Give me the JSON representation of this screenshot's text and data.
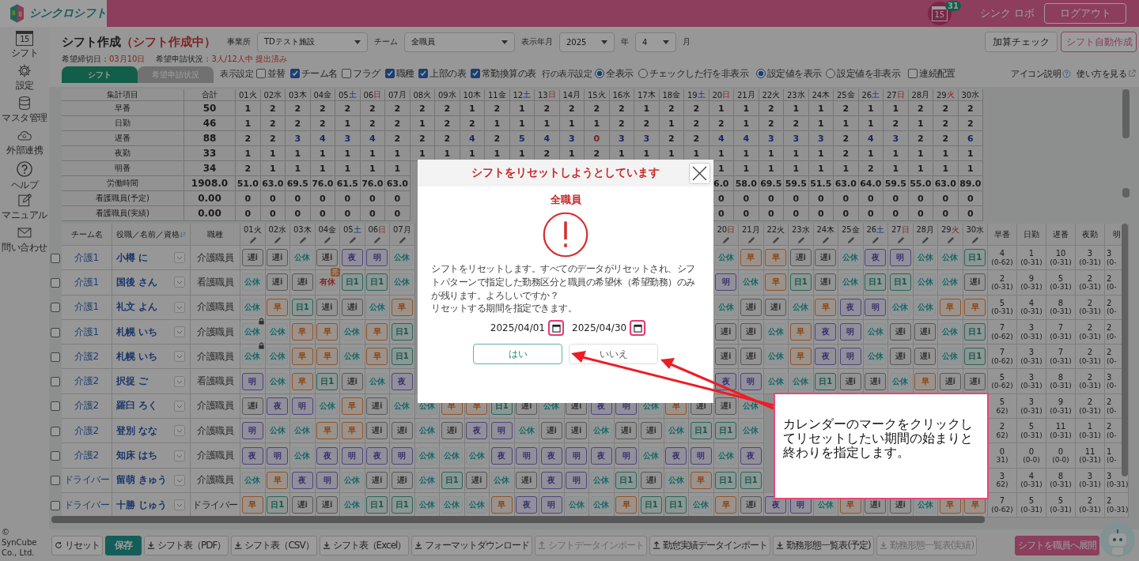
{
  "topbar": {
    "brand": "シンクロシフト",
    "calendar_day": "15",
    "notification_count": "31",
    "user": "シンク ロボ",
    "logout": "ログアウト"
  },
  "sidebar": {
    "items": [
      {
        "label": "シフト",
        "day": "15"
      },
      {
        "label": "設定"
      },
      {
        "label": "マスタ管理"
      },
      {
        "label": "外部連携"
      },
      {
        "label": "ヘルプ"
      },
      {
        "label": "マニュアル"
      },
      {
        "label": "問い合わせ"
      }
    ],
    "copyright": "© SynCube Co., Ltd."
  },
  "header": {
    "title": "シフト作成",
    "status": "（シフト作成中）",
    "filters": [
      {
        "label": "事業所",
        "value": "TDテスト施設"
      },
      {
        "label": "チーム",
        "value": "全職員"
      },
      {
        "label": "表示年月",
        "value": "2025",
        "unit": "年"
      },
      {
        "value": "4",
        "unit": "月"
      }
    ],
    "actions": [
      {
        "label": "加算チェック",
        "kind": "default"
      },
      {
        "label": "シフト自動作成",
        "kind": "accent"
      }
    ],
    "deadline": {
      "label": "希望締切日：",
      "value": "03月10日"
    },
    "requests": {
      "label": "希望申請状況：",
      "value": "3人/12人中 提出済み"
    }
  },
  "tabs": [
    {
      "label": "シフト",
      "selected": true
    },
    {
      "label": "希望申請状況",
      "selected": false
    }
  ],
  "settings": {
    "display_label": "表示設定",
    "checkboxes": [
      {
        "label": "並替",
        "checked": false
      },
      {
        "label": "チーム名",
        "checked": true
      },
      {
        "label": "フラグ",
        "checked": false
      },
      {
        "label": "職種",
        "checked": true
      },
      {
        "label": "上部の表",
        "checked": true
      },
      {
        "label": "常勤換算の表",
        "checked": true
      }
    ],
    "row_label": "行の表示設定",
    "radio_groups": [
      [
        {
          "label": "全表示",
          "selected": true
        },
        {
          "label": "チェックした行を非表示",
          "selected": false
        }
      ],
      [
        {
          "label": "設定値を表示",
          "selected": true
        },
        {
          "label": "設定値を非表示",
          "selected": false
        }
      ]
    ],
    "extra_checkbox": {
      "label": "連続配置",
      "checked": false
    },
    "icon_help": "アイコン説明",
    "how_to": "使い方を見る"
  },
  "summary": {
    "label_header": "集計項目",
    "total_header": "合計",
    "days": [
      {
        "date": "01",
        "weekday": "火",
        "kind": "weekday"
      },
      {
        "date": "02",
        "weekday": "水",
        "kind": "weekday"
      },
      {
        "date": "03",
        "weekday": "木",
        "kind": "weekday"
      },
      {
        "date": "04",
        "weekday": "金",
        "kind": "weekday"
      },
      {
        "date": "05",
        "weekday": "土",
        "kind": "saturday"
      },
      {
        "date": "06",
        "weekday": "日",
        "kind": "holiday"
      },
      {
        "date": "07",
        "weekday": "月",
        "kind": "weekday"
      },
      {
        "date": "08",
        "weekday": "火",
        "kind": "weekday"
      },
      {
        "date": "09",
        "weekday": "水",
        "kind": "weekday"
      },
      {
        "date": "10",
        "weekday": "木",
        "kind": "weekday"
      },
      {
        "date": "11",
        "weekday": "金",
        "kind": "weekday"
      },
      {
        "date": "12",
        "weekday": "土",
        "kind": "saturday"
      },
      {
        "date": "13",
        "weekday": "日",
        "kind": "holiday"
      },
      {
        "date": "14",
        "weekday": "月",
        "kind": "weekday"
      },
      {
        "date": "15",
        "weekday": "火",
        "kind": "weekday"
      },
      {
        "date": "16",
        "weekday": "水",
        "kind": "weekday"
      },
      {
        "date": "17",
        "weekday": "木",
        "kind": "weekday"
      },
      {
        "date": "18",
        "weekday": "金",
        "kind": "weekday"
      },
      {
        "date": "19",
        "weekday": "土",
        "kind": "saturday"
      },
      {
        "date": "20",
        "weekday": "日",
        "kind": "holiday"
      },
      {
        "date": "21",
        "weekday": "月",
        "kind": "weekday"
      },
      {
        "date": "22",
        "weekday": "火",
        "kind": "weekday"
      },
      {
        "date": "23",
        "weekday": "水",
        "kind": "weekday"
      },
      {
        "date": "24",
        "weekday": "木",
        "kind": "weekday"
      },
      {
        "date": "25",
        "weekday": "金",
        "kind": "weekday"
      },
      {
        "date": "26",
        "weekday": "土",
        "kind": "saturday"
      },
      {
        "date": "27",
        "weekday": "日",
        "kind": "holiday"
      },
      {
        "date": "28",
        "weekday": "月",
        "kind": "weekday"
      },
      {
        "date": "29",
        "weekday": "火",
        "kind": "holiday"
      },
      {
        "date": "30",
        "weekday": "水",
        "kind": "weekday"
      }
    ],
    "rows": [
      {
        "label": "早番",
        "total": "50",
        "values": [
          "1",
          "2",
          "2",
          "2",
          "2",
          "2",
          "2",
          "2",
          "2",
          "1",
          "2",
          "1",
          "2",
          "2",
          "2",
          "2",
          "1",
          "2",
          "2",
          "1",
          "1",
          "2",
          "1",
          "1",
          "2",
          "1",
          "1",
          "2",
          "2",
          "2"
        ]
      },
      {
        "label": "日勤",
        "total": "46",
        "values": [
          "1",
          "2",
          "2",
          "2",
          "1",
          "2",
          "2",
          "1",
          "2",
          "2",
          "1",
          "1",
          "1",
          "1",
          "1",
          "2",
          "2",
          "1",
          "2",
          "2",
          "1",
          "2",
          "2",
          "1",
          "1",
          "1",
          "2",
          "1",
          "2",
          "2"
        ]
      },
      {
        "label": "遅番",
        "total": "88",
        "cells": [
          {
            "text": "2",
            "kind": "normal"
          },
          {
            "text": "2",
            "kind": "normal"
          },
          {
            "text": "3",
            "kind": "over"
          },
          {
            "text": "4",
            "kind": "over"
          },
          {
            "text": "3",
            "kind": "over"
          },
          {
            "text": "4",
            "kind": "over"
          },
          {
            "text": "2",
            "kind": "normal"
          },
          {
            "text": "2",
            "kind": "normal"
          },
          {
            "text": "2",
            "kind": "normal"
          },
          {
            "text": "4",
            "kind": "over"
          },
          {
            "text": "2",
            "kind": "normal"
          },
          {
            "text": "5",
            "kind": "over"
          },
          {
            "text": "4",
            "kind": "over"
          },
          {
            "text": "3",
            "kind": "over"
          },
          {
            "text": "0",
            "kind": "short"
          },
          {
            "text": "3",
            "kind": "over"
          },
          {
            "text": "3",
            "kind": "over"
          },
          {
            "text": "2",
            "kind": "normal"
          },
          {
            "text": "2",
            "kind": "normal"
          },
          {
            "text": "4",
            "kind": "over"
          },
          {
            "text": "4",
            "kind": "over"
          },
          {
            "text": "3",
            "kind": "over"
          },
          {
            "text": "3",
            "kind": "over"
          },
          {
            "text": "3",
            "kind": "over"
          },
          {
            "text": "2",
            "kind": "normal"
          },
          {
            "text": "4",
            "kind": "over"
          },
          {
            "text": "3",
            "kind": "over"
          },
          {
            "text": "2",
            "kind": "normal"
          },
          {
            "text": "2",
            "kind": "normal"
          },
          {
            "text": "6",
            "kind": "over"
          }
        ]
      },
      {
        "label": "夜勤",
        "total": "33",
        "values": [
          "1",
          "1",
          "1",
          "1",
          "1",
          "1",
          "1",
          "1",
          "1",
          "1",
          "1",
          "1",
          "2",
          "1",
          "2",
          "1",
          "1",
          "1",
          "1",
          "1",
          "1",
          "1",
          "1",
          "1",
          "2",
          "1",
          "1",
          "1",
          "1",
          "1"
        ]
      },
      {
        "label": "明番",
        "total": "34",
        "values": [
          "2",
          "1",
          "1",
          "1",
          "1",
          "1",
          "1"
        ],
        "values_end": [
          "1",
          "1",
          "1",
          "1",
          "1",
          "1",
          "2",
          "1",
          "1",
          "1",
          "1"
        ]
      },
      {
        "label": "労働時間",
        "total": "1908.0",
        "values": [
          "51.0",
          "63.0",
          "69.5",
          "76.0",
          "61.5",
          "76.0",
          "63.0"
        ],
        "values_end": [
          "6.0",
          "58.0",
          "69.5",
          "59.5",
          "51.5",
          "63.0",
          "64.0",
          "59.5",
          "55.0",
          "63.0",
          "89.0"
        ]
      },
      {
        "label": "看護職員(予定)",
        "total": "0.00",
        "values": [
          "0",
          "0",
          "0",
          "0",
          "0",
          "0",
          "0"
        ],
        "values_end": [
          "0",
          "0",
          "0",
          "0",
          "0",
          "0",
          "0",
          "0",
          "0",
          "0",
          "0"
        ]
      },
      {
        "label": "看護職員(実績)",
        "total": "0.00",
        "values": [
          "0",
          "0",
          "0",
          "0",
          "0",
          "0",
          "0"
        ],
        "values_end": [
          "0",
          "0",
          "0",
          "0",
          "0",
          "0",
          "0",
          "0",
          "0",
          "0",
          "0"
        ]
      }
    ]
  },
  "staff": {
    "headers": {
      "team": "チーム名",
      "name": "役職／名前／資格",
      "role": "職種"
    },
    "days": [
      {
        "date": "01",
        "weekday": "火",
        "kind": "weekday"
      },
      {
        "date": "02",
        "weekday": "水",
        "kind": "weekday"
      },
      {
        "date": "03",
        "weekday": "木",
        "kind": "weekday"
      },
      {
        "date": "04",
        "weekday": "金",
        "kind": "weekday"
      },
      {
        "date": "05",
        "weekday": "土",
        "kind": "saturday"
      },
      {
        "date": "06",
        "weekday": "日",
        "kind": "holiday"
      },
      {
        "date": "07",
        "weekday": "月",
        "kind": "weekday"
      }
    ],
    "days_end": [
      {
        "date": "20",
        "weekday": "日",
        "kind": "holiday"
      },
      {
        "date": "21",
        "weekday": "月",
        "kind": "weekday"
      },
      {
        "date": "22",
        "weekday": "火",
        "kind": "weekday"
      },
      {
        "date": "23",
        "weekday": "水",
        "kind": "weekday"
      },
      {
        "date": "24",
        "weekday": "木",
        "kind": "weekday"
      },
      {
        "date": "25",
        "weekday": "金",
        "kind": "weekday"
      },
      {
        "date": "26",
        "weekday": "土",
        "kind": "saturday"
      },
      {
        "date": "27",
        "weekday": "日",
        "kind": "holiday"
      },
      {
        "date": "28",
        "weekday": "月",
        "kind": "weekday"
      },
      {
        "date": "29",
        "weekday": "火",
        "kind": "holiday"
      },
      {
        "date": "30",
        "weekday": "水",
        "kind": "weekday"
      }
    ],
    "total_headers": [
      "早番",
      "日勤",
      "遅番",
      "夜勤",
      "明"
    ],
    "rows": [
      {
        "checked": false,
        "team": "介護1",
        "name": "小樽 に",
        "role": "介護職員",
        "cells": [
          {
            "text": "遅i",
            "kind": "late"
          },
          {
            "text": "遅i",
            "kind": "late"
          },
          {
            "text": "公休",
            "kind": "off"
          },
          {
            "text": "遅i",
            "kind": "late"
          },
          {
            "text": "夜",
            "kind": "night"
          },
          {
            "text": "明",
            "kind": "after"
          },
          {
            "text": "公休",
            "kind": "off"
          }
        ],
        "cells_end": [
          {
            "text": "公休",
            "kind": "off"
          },
          {
            "text": "早",
            "kind": "early"
          },
          {
            "text": "早",
            "kind": "early"
          },
          {
            "text": "遅i",
            "kind": "late"
          },
          {
            "text": "遅i",
            "kind": "late"
          },
          {
            "text": "公休",
            "kind": "off"
          },
          {
            "text": "夜",
            "kind": "night"
          },
          {
            "text": "明",
            "kind": "after"
          },
          {
            "text": "公休",
            "kind": "off"
          },
          {
            "text": "公休",
            "kind": "off"
          },
          {
            "text": "日1",
            "kind": "day"
          }
        ],
        "totals": [
          {
            "count": "4",
            "range": "(0-62)"
          },
          {
            "count": "1",
            "range": "(0-31)"
          },
          {
            "count": "10",
            "range": "(0-31)"
          },
          {
            "count": "3",
            "range": "(0-31)"
          },
          {
            "count": "3",
            "range": "(0-"
          }
        ]
      },
      {
        "checked": false,
        "team": "介護1",
        "name": "国後 さん",
        "role": "看護職員",
        "cells": [
          {
            "text": "公休",
            "kind": "off"
          },
          {
            "text": "遅i",
            "kind": "late"
          },
          {
            "text": "遅i",
            "kind": "late"
          },
          {
            "text": "有休",
            "kind": "paid",
            "badge": "希"
          },
          {
            "text": "日1",
            "kind": "day"
          },
          {
            "text": "日1",
            "kind": "day"
          },
          {
            "text": "公休",
            "kind": "off"
          }
        ],
        "cells_end": [
          {
            "text": "明",
            "kind": "after"
          },
          {
            "text": "公休",
            "kind": "off"
          },
          {
            "text": "早",
            "kind": "early"
          },
          {
            "text": "日1",
            "kind": "day"
          },
          {
            "text": "遅i",
            "kind": "late"
          },
          {
            "text": "公休",
            "kind": "off"
          },
          {
            "text": "日1",
            "kind": "day"
          },
          {
            "text": "日1",
            "kind": "day"
          },
          {
            "text": "公休",
            "kind": "off"
          },
          {
            "text": "公休",
            "kind": "off"
          },
          {
            "text": "遅i",
            "kind": "late"
          }
        ],
        "totals": [
          {
            "count": "2",
            "range": "(0-31)"
          },
          {
            "count": "9",
            "range": "(0-31)"
          },
          {
            "count": "5",
            "range": "(0-31)"
          },
          {
            "count": "2",
            "range": "(0-31)"
          },
          {
            "count": "2",
            "range": "(0-"
          }
        ]
      },
      {
        "checked": false,
        "team": "介護1",
        "name": "礼文 よん",
        "role": "介護職員",
        "cells": [
          {
            "text": "公休",
            "kind": "off"
          },
          {
            "text": "早",
            "kind": "early"
          },
          {
            "text": "日1",
            "kind": "day"
          },
          {
            "text": "遅i",
            "kind": "late"
          },
          {
            "text": "遅i",
            "kind": "late"
          },
          {
            "text": "公休",
            "kind": "off"
          },
          {
            "text": "早",
            "kind": "early"
          }
        ],
        "cells_end": [
          {
            "text": "公休",
            "kind": "off"
          },
          {
            "text": "遅i",
            "kind": "late"
          },
          {
            "text": "遅i",
            "kind": "late"
          },
          {
            "text": "公休",
            "kind": "off"
          },
          {
            "text": "早",
            "kind": "early"
          },
          {
            "text": "夜",
            "kind": "night"
          },
          {
            "text": "明",
            "kind": "after"
          },
          {
            "text": "公休",
            "kind": "off"
          },
          {
            "text": "公休",
            "kind": "off"
          },
          {
            "text": "早",
            "kind": "early"
          },
          {
            "text": "早",
            "kind": "early"
          }
        ],
        "totals": [
          {
            "count": "5",
            "range": "(0-31)"
          },
          {
            "count": "4",
            "range": "(0-31)"
          },
          {
            "count": "8",
            "range": "(0-31)"
          },
          {
            "count": "2",
            "range": "(0-31)"
          },
          {
            "count": "2",
            "range": "(0-"
          }
        ]
      },
      {
        "checked": false,
        "team": "介護1",
        "name": "札幌 いち",
        "role": "介護職員",
        "cells": [
          {
            "text": "公休",
            "kind": "off",
            "locked": true
          },
          {
            "text": "公休",
            "kind": "off"
          },
          {
            "text": "早",
            "kind": "early"
          },
          {
            "text": "早",
            "kind": "early"
          },
          {
            "text": "公休",
            "kind": "off"
          },
          {
            "text": "早",
            "kind": "early"
          },
          {
            "text": "日1",
            "kind": "day"
          }
        ],
        "cells_end": [
          {
            "text": "遅i",
            "kind": "late"
          },
          {
            "text": "遅i",
            "kind": "late"
          },
          {
            "text": "公休",
            "kind": "off"
          },
          {
            "text": "早",
            "kind": "early"
          },
          {
            "text": "夜",
            "kind": "night"
          },
          {
            "text": "明",
            "kind": "after"
          },
          {
            "text": "公休",
            "kind": "off"
          },
          {
            "text": "遅i",
            "kind": "late"
          },
          {
            "text": "遅i",
            "kind": "late"
          },
          {
            "text": "公休",
            "kind": "off"
          },
          {
            "text": "日1",
            "kind": "day"
          }
        ],
        "totals": [
          {
            "count": "7",
            "range": "(0-62)"
          },
          {
            "count": "3",
            "range": "(0-31)"
          },
          {
            "count": "7",
            "range": "(0-31)"
          },
          {
            "count": "2",
            "range": "(0-31)"
          },
          {
            "count": "2",
            "range": "(0-"
          }
        ]
      },
      {
        "checked": false,
        "team": "介護2",
        "name": "札幌 いち",
        "role": "介護職員",
        "cells": [
          {
            "text": "公休",
            "kind": "off",
            "locked": true
          },
          {
            "text": "公休",
            "kind": "off"
          },
          {
            "text": "早",
            "kind": "early"
          },
          {
            "text": "早",
            "kind": "early"
          },
          {
            "text": "公休",
            "kind": "off"
          },
          {
            "text": "早",
            "kind": "early"
          },
          {
            "text": "日1",
            "kind": "day"
          }
        ],
        "cells_end": [
          {
            "text": "遅i",
            "kind": "late"
          },
          {
            "text": "遅i",
            "kind": "late"
          },
          {
            "text": "公休",
            "kind": "off"
          },
          {
            "text": "早",
            "kind": "early"
          },
          {
            "text": "夜",
            "kind": "night"
          },
          {
            "text": "明",
            "kind": "after"
          },
          {
            "text": "公休",
            "kind": "off"
          },
          {
            "text": "遅i",
            "kind": "late"
          },
          {
            "text": "遅i",
            "kind": "late"
          },
          {
            "text": "公休",
            "kind": "off"
          },
          {
            "text": "日1",
            "kind": "day"
          }
        ],
        "totals": [
          {
            "count": "7",
            "range": "(0-62)"
          },
          {
            "count": "3",
            "range": "(0-31)"
          },
          {
            "count": "7",
            "range": "(0-31)"
          },
          {
            "count": "2",
            "range": "(0-31)"
          },
          {
            "count": "2",
            "range": "(0-"
          }
        ]
      },
      {
        "checked": false,
        "team": "介護2",
        "name": "択捉 ご",
        "role": "看護職員",
        "cells": [
          {
            "text": "明",
            "kind": "after"
          },
          {
            "text": "公休",
            "kind": "off"
          },
          {
            "text": "早",
            "kind": "early"
          },
          {
            "text": "日1",
            "kind": "day"
          },
          {
            "text": "遅i",
            "kind": "late"
          },
          {
            "text": "公休",
            "kind": "off"
          },
          {
            "text": "夜",
            "kind": "night"
          }
        ],
        "cells_end": [
          {
            "text": "夜",
            "kind": "night"
          },
          {
            "text": "明",
            "kind": "after"
          },
          {
            "text": "公休",
            "kind": "off"
          },
          {
            "text": "公休",
            "kind": "off"
          },
          {
            "text": "日1",
            "kind": "day"
          },
          {
            "text": "遅i",
            "kind": "late"
          },
          {
            "text": "遅i",
            "kind": "late"
          },
          {
            "text": "公休",
            "kind": "off"
          },
          {
            "text": "早",
            "kind": "early"
          },
          {
            "text": "遅i",
            "kind": "late"
          },
          {
            "text": "遅i",
            "kind": "late"
          }
        ],
        "totals": [
          {
            "count": "5",
            "range": "(0-62)"
          },
          {
            "count": "3",
            "range": "(0-31)"
          },
          {
            "count": "8",
            "range": "(0-31)"
          },
          {
            "count": "2",
            "range": "(0-31)"
          },
          {
            "count": "3",
            "range": "(0-"
          }
        ]
      },
      {
        "checked": false,
        "team": "介護2",
        "name": "羅臼 ろく",
        "role": "介護職員",
        "cells": [
          {
            "text": "遅i",
            "kind": "late"
          },
          {
            "text": "夜",
            "kind": "night"
          },
          {
            "text": "明",
            "kind": "after"
          },
          {
            "text": "公休",
            "kind": "off"
          },
          {
            "text": "早",
            "kind": "early"
          },
          {
            "text": "遅i",
            "kind": "late"
          },
          {
            "text": "公休",
            "kind": "off"
          },
          {
            "text": "公休",
            "kind": "off"
          },
          {
            "text": "早",
            "kind": "early"
          },
          {
            "text": "早",
            "kind": "early"
          },
          {
            "text": "日1",
            "kind": "day"
          },
          {
            "text": "遅i",
            "kind": "late"
          },
          {
            "text": "公休",
            "kind": "off"
          },
          {
            "text": "遅i",
            "kind": "late"
          },
          {
            "text": "夜",
            "kind": "night"
          },
          {
            "text": "明",
            "kind": "after"
          },
          {
            "text": "公休",
            "kind": "off"
          },
          {
            "text": "早",
            "kind": "early"
          },
          {
            "text": "遅i",
            "kind": "late"
          },
          {
            "text": "遅i",
            "kind": "late"
          },
          {
            "text": "公休",
            "kind": "off"
          }
        ],
        "totals": [
          {
            "count": "5",
            "range": "62)"
          },
          {
            "count": "3",
            "range": "(0-31)"
          },
          {
            "count": "9",
            "range": "(0-31)"
          },
          {
            "count": "2",
            "range": "(0-31)"
          },
          {
            "count": "2",
            "range": "(0-"
          }
        ]
      },
      {
        "checked": false,
        "team": "介護2",
        "name": "登別 なな",
        "role": "介護職員",
        "cells": [
          {
            "text": "明",
            "kind": "after"
          },
          {
            "text": "公休",
            "kind": "off"
          },
          {
            "text": "公休",
            "kind": "off"
          },
          {
            "text": "早",
            "kind": "early"
          },
          {
            "text": "早",
            "kind": "early"
          },
          {
            "text": "遅i",
            "kind": "late"
          },
          {
            "text": "遅i",
            "kind": "late"
          },
          {
            "text": "公休",
            "kind": "off"
          },
          {
            "text": "遅i",
            "kind": "late"
          },
          {
            "text": "夜",
            "kind": "night"
          },
          {
            "text": "明",
            "kind": "after"
          },
          {
            "text": "公休",
            "kind": "off"
          },
          {
            "text": "遅i",
            "kind": "late"
          },
          {
            "text": "遅i",
            "kind": "late"
          },
          {
            "text": "公休",
            "kind": "off"
          },
          {
            "text": "遅i",
            "kind": "late"
          },
          {
            "text": "遅i",
            "kind": "late"
          },
          {
            "text": "公休",
            "kind": "off"
          },
          {
            "text": "日1",
            "kind": "day"
          },
          {
            "text": "日1",
            "kind": "day"
          },
          {
            "text": "公休",
            "kind": "off"
          }
        ],
        "totals": [
          {
            "count": "2",
            "range": "62)"
          },
          {
            "count": "5",
            "range": "(0-31)"
          },
          {
            "count": "11",
            "range": "(0-31)"
          },
          {
            "count": "1",
            "range": "(0-31)"
          },
          {
            "count": "2",
            "range": "(0-"
          }
        ]
      },
      {
        "checked": false,
        "team": "介護2",
        "name": "知床 はち",
        "role": "介護職員",
        "cells": [
          {
            "text": "夜",
            "kind": "night"
          },
          {
            "text": "明",
            "kind": "after"
          },
          {
            "text": "公休",
            "kind": "off"
          },
          {
            "text": "夜",
            "kind": "night"
          },
          {
            "text": "明",
            "kind": "after"
          },
          {
            "text": "夜",
            "kind": "night"
          },
          {
            "text": "明",
            "kind": "after"
          },
          {
            "text": "公休",
            "kind": "off"
          },
          {
            "text": "公休",
            "kind": "off"
          },
          {
            "text": "公休",
            "kind": "off"
          },
          {
            "text": "夜",
            "kind": "night"
          },
          {
            "text": "明",
            "kind": "after"
          },
          {
            "text": "夜",
            "kind": "night"
          },
          {
            "text": "明",
            "kind": "after"
          },
          {
            "text": "夜",
            "kind": "night"
          },
          {
            "text": "明",
            "kind": "after"
          },
          {
            "text": "公休",
            "kind": "off"
          },
          {
            "text": "夜",
            "kind": "night"
          },
          {
            "text": "明",
            "kind": "after"
          },
          {
            "text": "公休",
            "kind": "off"
          },
          {
            "text": "夜",
            "kind": "night"
          }
        ],
        "totals": [
          {
            "count": "0",
            "range": "31)"
          },
          {
            "count": "0",
            "range": "(0-0)"
          },
          {
            "count": "0",
            "range": "(0-0)"
          },
          {
            "count": "11",
            "range": "(0-31)"
          },
          {
            "count": "1",
            "range": "(0-"
          }
        ]
      },
      {
        "checked": false,
        "team": "ドライバー",
        "name": "留萌 きゅう",
        "role": "介護職員",
        "cells": [
          {
            "text": "公休",
            "kind": "off"
          },
          {
            "text": "早",
            "kind": "early"
          },
          {
            "text": "夜",
            "kind": "night"
          },
          {
            "text": "明",
            "kind": "after"
          },
          {
            "text": "公休",
            "kind": "off"
          },
          {
            "text": "遅i",
            "kind": "late"
          },
          {
            "text": "遅i",
            "kind": "late"
          },
          {
            "text": "公休",
            "kind": "off"
          },
          {
            "text": "日1",
            "kind": "day"
          },
          {
            "text": "遅i",
            "kind": "late"
          },
          {
            "text": "公休",
            "kind": "off"
          },
          {
            "text": "遅i",
            "kind": "late"
          },
          {
            "text": "夜",
            "kind": "night"
          },
          {
            "text": "明",
            "kind": "after"
          },
          {
            "text": "公休",
            "kind": "off"
          },
          {
            "text": "日1",
            "kind": "day"
          },
          {
            "text": "遅i",
            "kind": "late"
          },
          {
            "text": "公休",
            "kind": "off"
          },
          {
            "text": "早",
            "kind": "early"
          },
          {
            "text": "日1",
            "kind": "day"
          },
          {
            "text": "日1",
            "kind": "day"
          }
        ],
        "totals": [
          {
            "count": "3",
            "range": "62)"
          },
          {
            "count": "4",
            "range": "(0-31)"
          },
          {
            "count": "8",
            "range": "(0-31)"
          },
          {
            "count": "3",
            "range": "(0-31)"
          },
          {
            "count": "3",
            "range": "(0-31)"
          }
        ]
      },
      {
        "checked": false,
        "team": "ドライバー",
        "name": "十勝 じゅう",
        "role": "ドライバー",
        "cells": [
          {
            "text": "早",
            "kind": "early"
          },
          {
            "text": "日1",
            "kind": "day"
          },
          {
            "text": "遅i",
            "kind": "late"
          },
          {
            "text": "遅i",
            "kind": "late"
          },
          {
            "text": "公休",
            "kind": "off"
          },
          {
            "text": "日1",
            "kind": "day"
          },
          {
            "text": "日1",
            "kind": "day"
          },
          {
            "text": "公休",
            "kind": "off"
          },
          {
            "text": "公休",
            "kind": "off"
          },
          {
            "text": "公休",
            "kind": "off"
          },
          {
            "text": "早",
            "kind": "early"
          },
          {
            "text": "夜",
            "kind": "night"
          },
          {
            "text": "明",
            "kind": "after"
          },
          {
            "text": "公休",
            "kind": "off"
          },
          {
            "text": "公休",
            "kind": "off"
          },
          {
            "text": "早",
            "kind": "early"
          },
          {
            "text": "日1",
            "kind": "day"
          },
          {
            "text": "日1",
            "kind": "day"
          },
          {
            "text": "公休",
            "kind": "off"
          },
          {
            "text": "早",
            "kind": "early"
          },
          {
            "text": "遅i",
            "kind": "late"
          },
          {
            "text": "夜",
            "kind": "night"
          },
          {
            "text": "明",
            "kind": "after"
          },
          {
            "text": "公休",
            "kind": "off"
          },
          {
            "text": "早",
            "kind": "early"
          },
          {
            "text": "遅i",
            "kind": "late"
          },
          {
            "text": "遅i",
            "kind": "late"
          },
          {
            "text": "公休",
            "kind": "off"
          },
          {
            "text": "早",
            "kind": "early"
          },
          {
            "text": "早",
            "kind": "early"
          }
        ],
        "totals": [
          {
            "count": "7",
            "range": "(0-62)"
          },
          {
            "count": "5",
            "range": "(0-31)"
          },
          {
            "count": "5",
            "range": "(0-31)"
          },
          {
            "count": "2",
            "range": "(0-31)"
          },
          {
            "count": "2",
            "range": "(0-31)"
          }
        ]
      }
    ]
  },
  "footer": [
    {
      "label": "リセット",
      "kind": "reset",
      "disabled": false
    },
    {
      "label": "保存",
      "kind": "save",
      "disabled": false
    },
    {
      "label": "シフト表（PDF）",
      "kind": "download",
      "disabled": false
    },
    {
      "label": "シフト表（CSV）",
      "kind": "download",
      "disabled": false
    },
    {
      "label": "シフト表（Excel）",
      "kind": "download",
      "disabled": false
    },
    {
      "label": "フォーマットダウンロード",
      "kind": "download",
      "disabled": false
    },
    {
      "label": "シフトデータインポート",
      "kind": "upload",
      "disabled": true
    },
    {
      "label": "勤怠実績データインポート",
      "kind": "upload",
      "disabled": false
    },
    {
      "label": "勤務形態一覧表(予定)",
      "kind": "download",
      "disabled": false
    },
    {
      "label": "勤務形態一覧表(実績)",
      "kind": "download",
      "disabled": true
    },
    {
      "label": "シフトを職員へ展開",
      "kind": "deploy",
      "disabled": false
    }
  ],
  "modal": {
    "title": "シフトをリセットしようとしています",
    "subtitle": "全職員",
    "message": [
      "シフトをリセットします。すべてのデータがリセットされ、シフトパターンで指定した勤務区分と職員の希望休（希望勤務）のみが残ります。よろしいですか？",
      "リセットする期間を指定できます。"
    ],
    "dates": [
      {
        "value": "2025/04/01",
        "highlighted": true
      },
      {
        "value": "2025/04/30",
        "highlighted": true
      }
    ],
    "confirm": "はい",
    "cancel": "いいえ"
  },
  "callout": {
    "text": "カレンダーのマークをクリックしてリセットしたい期間の始まりと終わりを指定します。"
  }
}
